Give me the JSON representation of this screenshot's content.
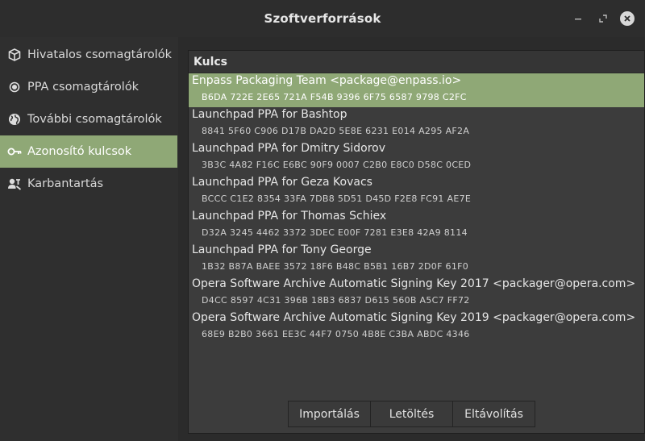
{
  "window": {
    "title": "Szoftverforrások",
    "controls": {
      "minimize": "‒",
      "maximize": "⤡",
      "close": "✕"
    }
  },
  "sidebar": {
    "items": [
      {
        "label": "Hivatalos csomagtárolók",
        "icon": "package-icon",
        "active": false
      },
      {
        "label": "PPA csomagtárolók",
        "icon": "ppa-icon",
        "active": false
      },
      {
        "label": "További csomagtárolók",
        "icon": "globe-icon",
        "active": false
      },
      {
        "label": "Azonosító kulcsok",
        "icon": "key-icon",
        "active": true
      },
      {
        "label": "Karbantartás",
        "icon": "maintenance-icon",
        "active": false
      }
    ]
  },
  "keys": {
    "header": "Kulcs",
    "items": [
      {
        "name": "Enpass Packaging Team <package@enpass.io>",
        "fingerprint": "B6DA 722E 2E65 721A F54B  9396 6F75 6587 9798 C2FC",
        "selected": true
      },
      {
        "name": "Launchpad PPA for Bashtop",
        "fingerprint": "8841 5F60 C906 D17B DA2D  5E8E 6231 E014 A295 AF2A",
        "selected": false
      },
      {
        "name": "Launchpad PPA for Dmitry Sidorov",
        "fingerprint": "3B3C 4A82 F16C E6BC 90F9  0007 C2B0 E8C0 D58C 0CED",
        "selected": false
      },
      {
        "name": "Launchpad PPA for Geza Kovacs",
        "fingerprint": "BCCC C1E2 8354 33FA 7DB8  5D51 D45D F2E8 FC91 AE7E",
        "selected": false
      },
      {
        "name": "Launchpad PPA for Thomas Schiex",
        "fingerprint": "D32A 3245 4462 3372 3DEC  E00F 7281 E3E8 42A9 8114",
        "selected": false
      },
      {
        "name": "Launchpad PPA for Tony George",
        "fingerprint": "1B32 B87A BAEE 3572 18F6  B48C B5B1 16B7 2D0F 61F0",
        "selected": false
      },
      {
        "name": "Opera Software Archive Automatic Signing Key 2017 <packager@opera.com>",
        "fingerprint": "D4CC 8597 4C31 396B 18B3  6837 D615 560B A5C7 FF72",
        "selected": false
      },
      {
        "name": "Opera Software Archive Automatic Signing Key 2019 <packager@opera.com>",
        "fingerprint": "68E9 B2B0 3661 EE3C 44F7  0750 4B8E C3BA ABDC 4346",
        "selected": false
      }
    ]
  },
  "buttons": {
    "import": "Importálás",
    "download": "Letöltés",
    "remove": "Eltávolítás"
  },
  "colors": {
    "accent": "#8fa876",
    "background": "#2f2f2f",
    "panel": "#3c3c3c"
  }
}
